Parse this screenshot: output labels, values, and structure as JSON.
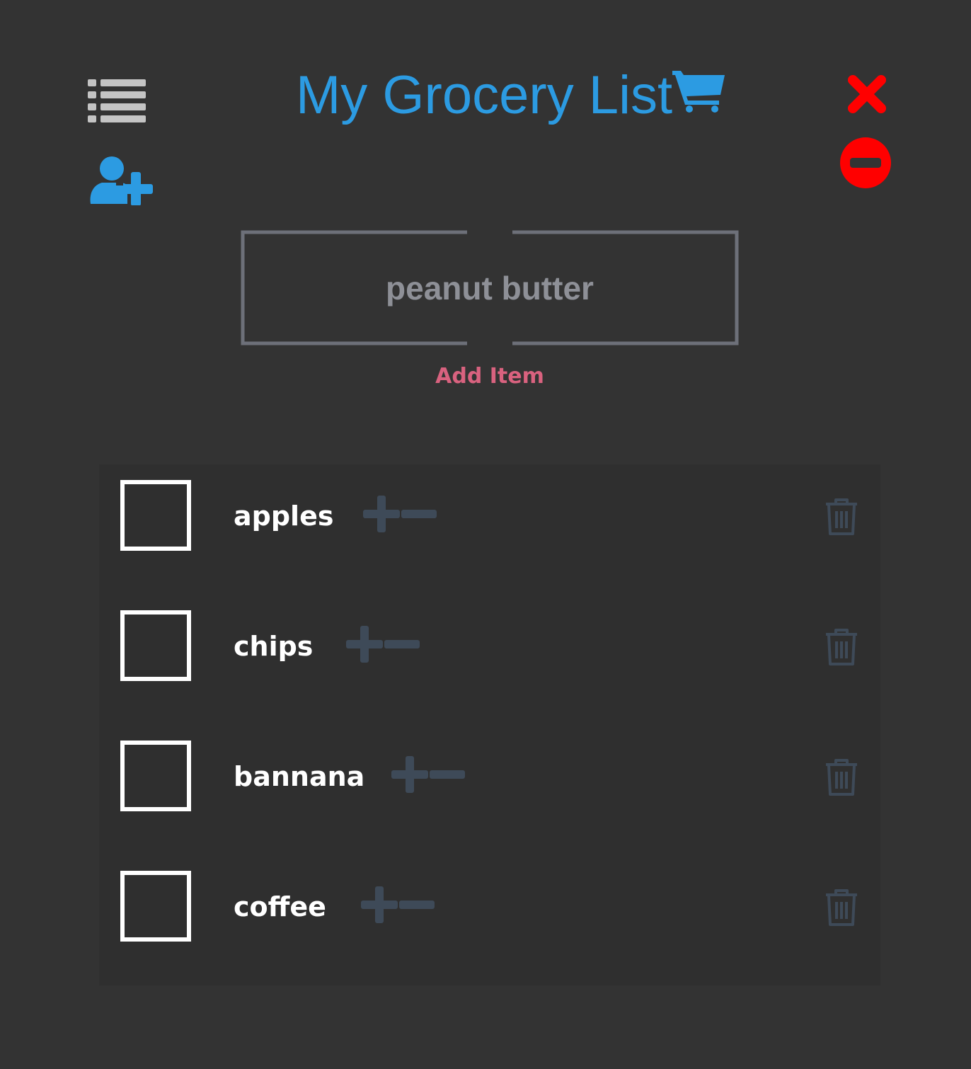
{
  "header": {
    "title": "My Grocery List",
    "menu_icon": "list-icon",
    "add_user_icon": "user-plus-icon",
    "cart_icon": "shopping-cart-icon",
    "close_icon": "close-icon",
    "remove_icon": "minus-circle-icon"
  },
  "form": {
    "input_value": "peanut butter",
    "add_label": "Add Item"
  },
  "colors": {
    "background": "#333333",
    "accent_blue": "#2c9be2",
    "danger_red": "#ff0000",
    "add_pink": "#d9627f",
    "muted_icon": "#3e4a58",
    "input_border": "#6d7079"
  },
  "items": [
    {
      "name": "apples"
    },
    {
      "name": "chips"
    },
    {
      "name": "bannana"
    },
    {
      "name": "coffee"
    }
  ]
}
